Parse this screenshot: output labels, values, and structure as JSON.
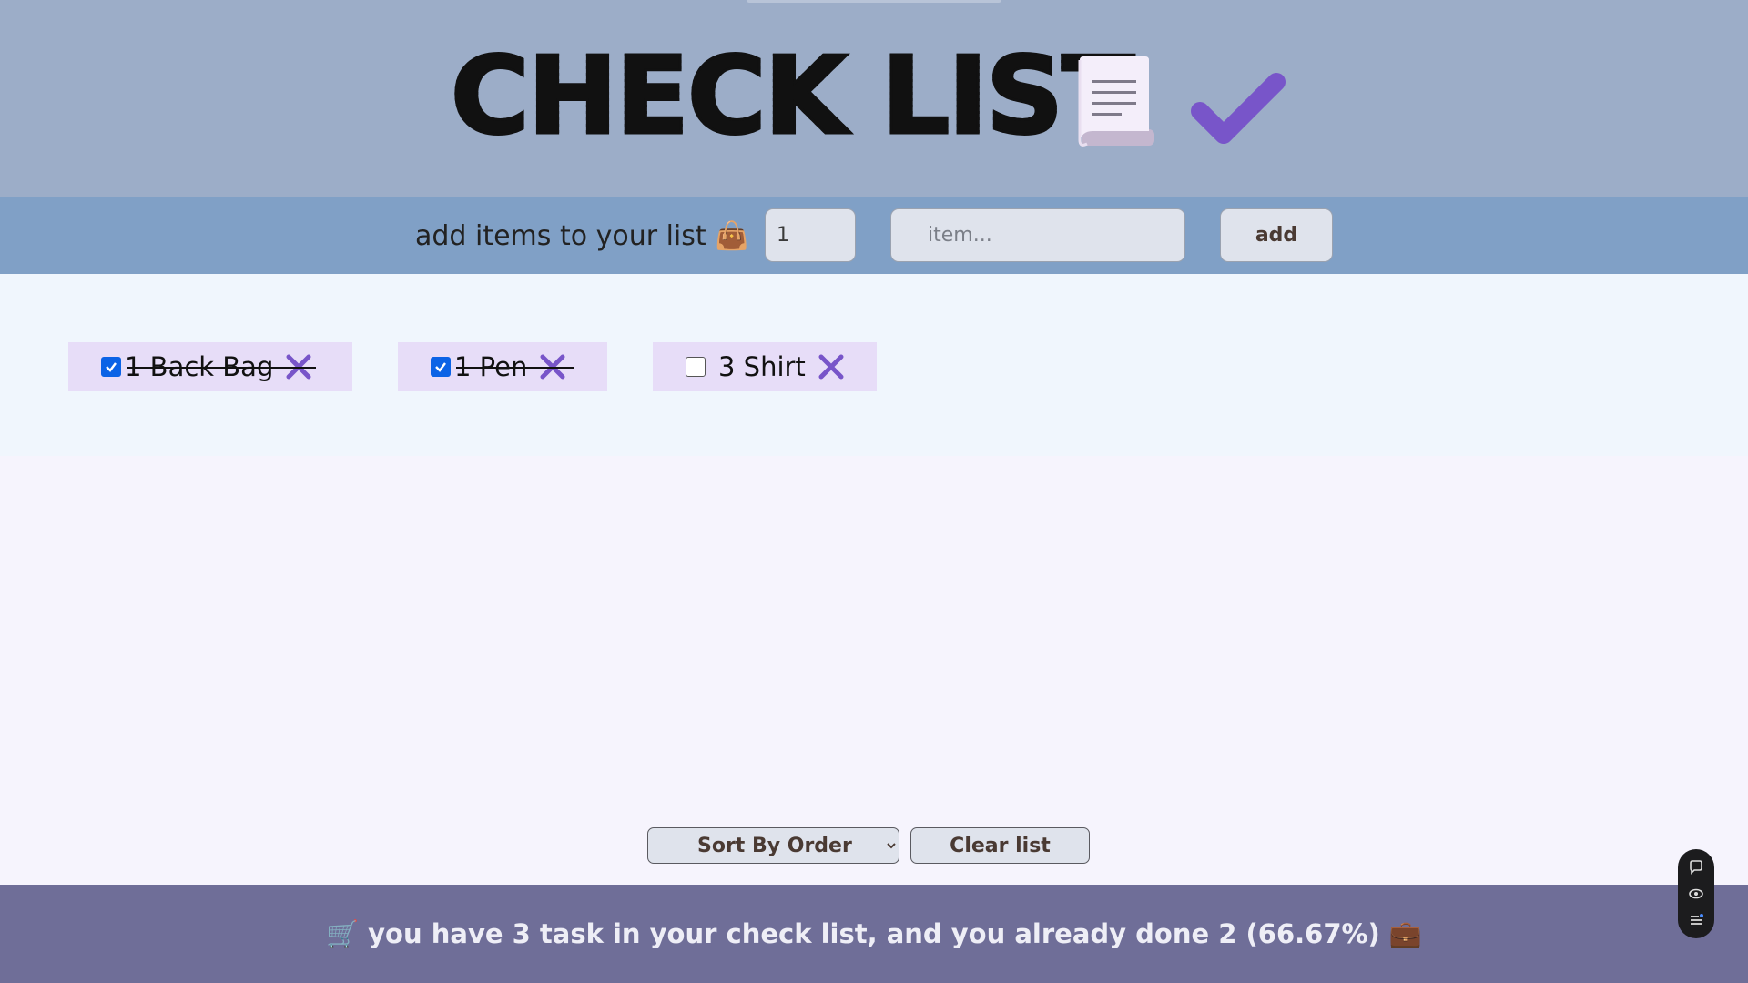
{
  "header": {
    "title": "CHECK LIST",
    "icons": [
      "scroll-icon",
      "checkmark-icon"
    ]
  },
  "add_bar": {
    "label": "add items to your list 👜",
    "quantity_value": "1",
    "item_placeholder": "item...",
    "add_label": "add"
  },
  "items": [
    {
      "text": "1 Back Bag",
      "checked": true
    },
    {
      "text": "1 Pen",
      "checked": true
    },
    {
      "text": "3 Shirt",
      "checked": false
    }
  ],
  "controls": {
    "sort_selected": "Sort By Order",
    "clear_label": "Clear list"
  },
  "footer": {
    "text": "🛒 you have 3 task in your check list, and you already done 2 (66.67%) 💼"
  },
  "colors": {
    "header_bg": "#9cadc8",
    "addbar_bg": "#80a0c6",
    "footer_bg": "#6f6e98",
    "item_bg": "#e7ddf8",
    "accent": "#7c5cc9",
    "checkbox_checked": "#0b63e6"
  }
}
